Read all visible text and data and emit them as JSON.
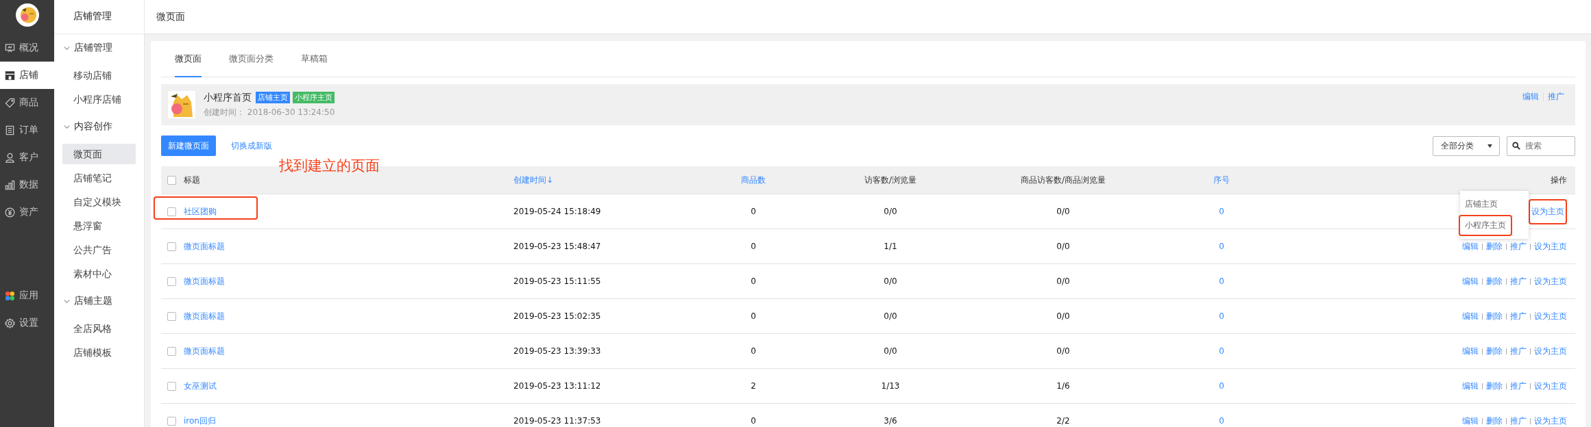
{
  "nav": {
    "main": [
      {
        "label": "概况",
        "selected": false
      },
      {
        "label": "店铺",
        "selected": true
      },
      {
        "label": "商品",
        "selected": false
      },
      {
        "label": "订单",
        "selected": false
      },
      {
        "label": "客户",
        "selected": false
      },
      {
        "label": "数据",
        "selected": false
      },
      {
        "label": "资产",
        "selected": false
      }
    ],
    "bottom": [
      {
        "label": "应用",
        "selected": false
      },
      {
        "label": "设置",
        "selected": false
      }
    ]
  },
  "sidebar": {
    "title": "店铺管理",
    "groups": [
      {
        "label": "店铺管理",
        "expanded": true,
        "children": [
          {
            "label": "移动店铺",
            "selected": false
          },
          {
            "label": "小程序店铺",
            "selected": false
          }
        ]
      },
      {
        "label": "内容创作",
        "expanded": true,
        "children": [
          {
            "label": "微页面",
            "selected": true
          },
          {
            "label": "店铺笔记",
            "selected": false
          },
          {
            "label": "自定义模块",
            "selected": false
          },
          {
            "label": "悬浮窗",
            "selected": false
          },
          {
            "label": "公共广告",
            "selected": false
          },
          {
            "label": "素材中心",
            "selected": false
          }
        ]
      },
      {
        "label": "店铺主题",
        "expanded": true,
        "children": [
          {
            "label": "全店风格",
            "selected": false
          },
          {
            "label": "店铺模板",
            "selected": false
          }
        ]
      }
    ]
  },
  "header": {
    "title": "微页面"
  },
  "tabs": [
    {
      "label": "微页面",
      "selected": true
    },
    {
      "label": "微页面分类",
      "selected": false
    },
    {
      "label": "草稿箱",
      "selected": false
    }
  ],
  "home_card": {
    "title": "小程序首页",
    "tags": [
      {
        "label": "店铺主页",
        "color": "#3388ff"
      },
      {
        "label": "小程序主页",
        "color": "#44bb66"
      }
    ],
    "created": "创建时间：  2018-06-30 13:24:50",
    "actions": [
      "编辑",
      "推广"
    ]
  },
  "toolbar": {
    "new_button": "新建微页面",
    "switch_link": "切换成新版",
    "category": "全部分类",
    "search": {
      "placeholder": "搜索"
    }
  },
  "annotation": "找到建立的页面",
  "table": {
    "all_checked": false,
    "columns": [
      {
        "label": "标题",
        "sortable": false
      },
      {
        "label": "创建时间",
        "sortable": true,
        "sort": "↓"
      },
      {
        "label": "商品数",
        "sortable": true
      },
      {
        "label": "访客数/浏览量",
        "sortable": false
      },
      {
        "label": "商品访客数/商品浏览量",
        "sortable": false
      },
      {
        "label": "序号",
        "sortable": true
      },
      {
        "label": "操作",
        "sortable": false
      }
    ],
    "rows": [
      {
        "title": "社区团购",
        "created": "2019-05-24 15:18:49",
        "goods": "0",
        "visitors": "0/0",
        "goods_visitors": "0/0",
        "order": "0",
        "checked": false,
        "marked": true,
        "actions": [
          "设为主页"
        ],
        "popover": [
          {
            "label": "店铺主页",
            "marked": false
          },
          {
            "label": "小程序主页",
            "marked": true
          }
        ]
      },
      {
        "title": "微页面标题",
        "created": "2019-05-23 15:48:47",
        "goods": "0",
        "visitors": "1/1",
        "goods_visitors": "0/0",
        "order": "0",
        "checked": false,
        "marked": false,
        "actions": [
          "编辑",
          "删除",
          "推广",
          "设为主页"
        ]
      },
      {
        "title": "微页面标题",
        "created": "2019-05-23 15:11:55",
        "goods": "0",
        "visitors": "0/0",
        "goods_visitors": "0/0",
        "order": "0",
        "checked": false,
        "marked": false,
        "actions": [
          "编辑",
          "删除",
          "推广",
          "设为主页"
        ]
      },
      {
        "title": "微页面标题",
        "created": "2019-05-23 15:02:35",
        "goods": "0",
        "visitors": "0/0",
        "goods_visitors": "0/0",
        "order": "0",
        "checked": false,
        "marked": false,
        "actions": [
          "编辑",
          "删除",
          "推广",
          "设为主页"
        ]
      },
      {
        "title": "微页面标题",
        "created": "2019-05-23 13:39:33",
        "goods": "0",
        "visitors": "0/0",
        "goods_visitors": "0/0",
        "order": "0",
        "checked": false,
        "marked": false,
        "actions": [
          "编辑",
          "删除",
          "推广",
          "设为主页"
        ]
      },
      {
        "title": "女巫测试",
        "created": "2019-05-23 13:11:12",
        "goods": "2",
        "visitors": "1/13",
        "goods_visitors": "1/6",
        "order": "0",
        "checked": false,
        "marked": false,
        "actions": [
          "编辑",
          "删除",
          "推广",
          "设为主页"
        ]
      },
      {
        "title": "iron回归",
        "created": "2019-05-23 11:37:53",
        "goods": "0",
        "visitors": "3/6",
        "goods_visitors": "2/2",
        "order": "0",
        "checked": false,
        "marked": false,
        "actions": [
          "编辑",
          "删除",
          "推广",
          "设为主页"
        ]
      }
    ]
  }
}
